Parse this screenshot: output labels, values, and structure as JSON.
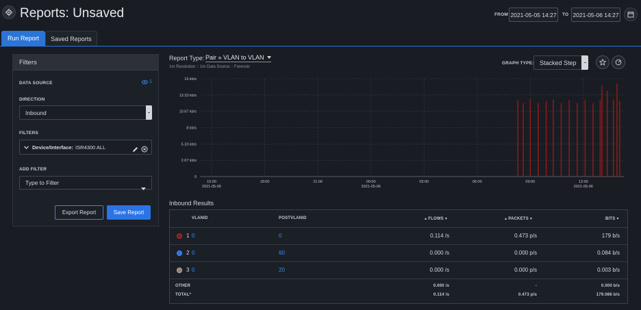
{
  "header": {
    "title": "Reports: Unsaved",
    "from_label": "FROM",
    "from_value": "2021-05-05 14:27",
    "to_label": "TO",
    "to_value": "2021-05-06 14:27",
    "settings_icon": "gear-icon",
    "calendar_icon": "calendar-icon"
  },
  "tabs": [
    {
      "label": "Run Report",
      "active": true
    },
    {
      "label": "Saved Reports",
      "active": false
    }
  ],
  "filters": {
    "title": "Filters",
    "data_source_label": "DATA SOURCE",
    "data_source_count": "1",
    "direction_label": "DIRECTION",
    "direction_value": "Inbound",
    "filters_label": "FILTERS",
    "filter_item_key": "Device/Interface:",
    "filter_item_value": "ISR4300 ALL",
    "add_filter_label": "ADD FILTER",
    "add_filter_placeholder": "Type to Filter",
    "export_label": "Export Report",
    "save_label": "Save Report"
  },
  "report": {
    "type_label": "Report Type:",
    "type_value": "Pair » VLAN to VLAN",
    "subtitle": "1m Resolution :: 1m Data Source :: Forensic",
    "graph_type_label": "GRAPH TYPE:",
    "graph_type_value": "Stacked Step"
  },
  "chart_data": {
    "type": "bar",
    "y_ticks": [
      "16 kb/s",
      "13.33 kb/s",
      "10.67 kb/s",
      "8 kb/s",
      "5.33 kb/s",
      "2.67 kb/s",
      "0"
    ],
    "x_ticks": [
      {
        "time": "15:00",
        "date": "2021-05-05"
      },
      {
        "time": "18:00",
        "date": ""
      },
      {
        "time": "21:00",
        "date": ""
      },
      {
        "time": "00:00",
        "date": "2021-05-06"
      },
      {
        "time": "03:00",
        "date": ""
      },
      {
        "time": "06:00",
        "date": ""
      },
      {
        "time": "09:00",
        "date": ""
      },
      {
        "time": "12:00",
        "date": "2021-05-06"
      }
    ],
    "ylim": [
      0,
      16
    ],
    "y_unit": "kb/s",
    "series": [
      {
        "color": "#8b1a1a",
        "spikes": [
          {
            "t": 8.3,
            "v": 12.5
          },
          {
            "t": 8.6,
            "v": 12.0
          },
          {
            "t": 9.0,
            "v": 12.6
          },
          {
            "t": 9.45,
            "v": 12.0
          },
          {
            "t": 9.9,
            "v": 12.4
          },
          {
            "t": 10.3,
            "v": 12.6
          },
          {
            "t": 10.75,
            "v": 12.0
          },
          {
            "t": 11.2,
            "v": 12.5
          },
          {
            "t": 11.65,
            "v": 12.0
          },
          {
            "t": 12.1,
            "v": 12.6
          },
          {
            "t": 12.55,
            "v": 12.0
          },
          {
            "t": 12.95,
            "v": 12.5
          },
          {
            "t": 13.05,
            "v": 15.0
          },
          {
            "t": 13.35,
            "v": 14.0
          },
          {
            "t": 13.7,
            "v": 12.6
          },
          {
            "t": 13.9,
            "v": 15.2
          },
          {
            "t": 14.05,
            "v": 12.4
          }
        ]
      }
    ]
  },
  "results": {
    "title": "Inbound Results",
    "columns": [
      "VLANID",
      "POSTVLANID",
      "FLOWS",
      "PACKETS",
      "BITS"
    ],
    "rows": [
      {
        "rank": "1",
        "vlanid": "0",
        "postvlanid": "0",
        "flows": "0.114 /s",
        "packets": "0.473 p/s",
        "bits": "179 b/s",
        "color": "#7a1f1f"
      },
      {
        "rank": "2",
        "vlanid": "0",
        "postvlanid": "60",
        "flows": "0.000 /s",
        "packets": "0.000 p/s",
        "bits": "0.084 b/s",
        "color": "#2f6fe0"
      },
      {
        "rank": "3",
        "vlanid": "0",
        "postvlanid": "20",
        "flows": "0.000 /s",
        "packets": "0.000 p/s",
        "bits": "0.003 b/s",
        "color": "#9a7a7a"
      }
    ],
    "other": {
      "label": "OTHER",
      "flows": "0.000 /s",
      "packets": "-",
      "bits": "0.000 b/s"
    },
    "total": {
      "label": "TOTAL*",
      "flows": "0.114 /s",
      "packets": "0.473 p/s",
      "bits": "179.086 b/s"
    }
  }
}
